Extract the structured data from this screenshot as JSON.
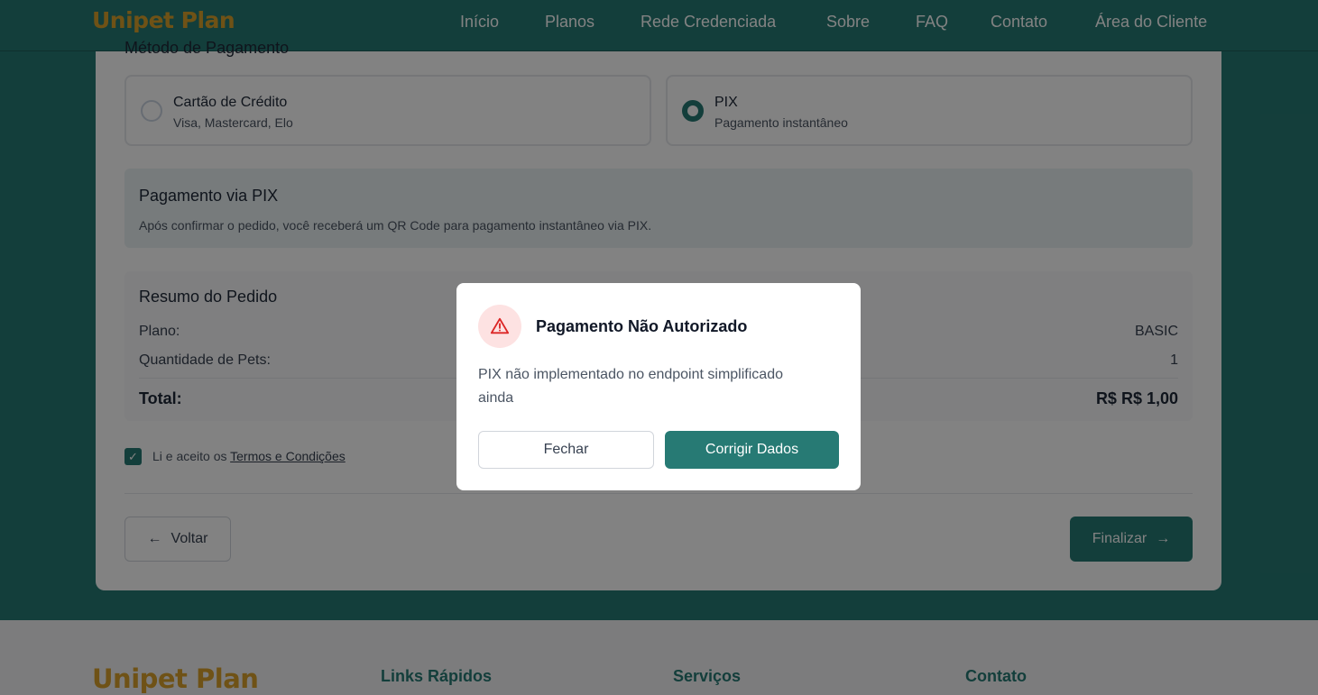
{
  "header": {
    "logo": "Unipet Plan",
    "nav": [
      "Início",
      "Planos",
      "Rede Credenciada",
      "Sobre",
      "FAQ",
      "Contato",
      "Área do Cliente"
    ]
  },
  "checkout": {
    "section_label": "Método de Pagamento",
    "payment_options": [
      {
        "title": "Cartão de Crédito",
        "subtitle": "Visa, Mastercard, Elo",
        "selected": false
      },
      {
        "title": "PIX",
        "subtitle": "Pagamento instantâneo",
        "selected": true
      }
    ],
    "pix_info": {
      "title": "Pagamento via PIX",
      "description": "Após confirmar o pedido, você receberá um QR Code para pagamento instantâneo via PIX."
    },
    "summary": {
      "title": "Resumo do Pedido",
      "plan_label": "Plano:",
      "plan_value": "BASIC",
      "pets_label": "Quantidade de Pets:",
      "pets_value": "1",
      "total_label": "Total:",
      "total_value": "R$ R$ 1,00"
    },
    "terms": {
      "prefix": "Li e aceito os",
      "link": "Termos e Condições",
      "checked": true
    },
    "back_label": "Voltar",
    "finish_label": "Finalizar"
  },
  "footer": {
    "logo": "Unipet Plan",
    "headings": [
      "Links Rápidos",
      "Serviços",
      "Contato"
    ]
  },
  "modal": {
    "title": "Pagamento Não Autorizado",
    "message": "PIX não implementado no endpoint simplificado ainda",
    "close_label": "Fechar",
    "fix_label": "Corrigir Dados"
  },
  "colors": {
    "brand": "#277a74",
    "logo": "#d9a22b",
    "warning_bg": "#fde2e2",
    "warning_icon": "#dc2626"
  }
}
